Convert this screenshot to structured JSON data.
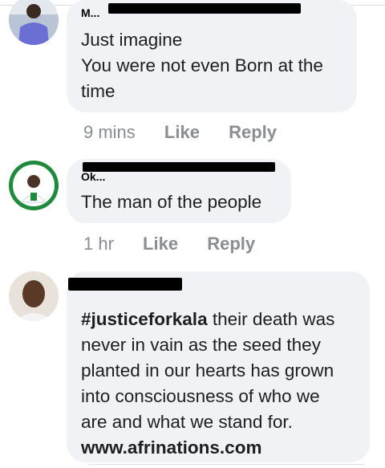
{
  "comments": [
    {
      "author": "M...",
      "lines": [
        "Just imagine",
        "You were not even Born at the",
        "time"
      ],
      "time": "9 mins",
      "like": "Like",
      "reply": "Reply"
    },
    {
      "author": "Ok...",
      "lines": [
        "The man of the people"
      ],
      "time": "1 hr",
      "like": "Like",
      "reply": "Reply"
    },
    {
      "author": "",
      "hashtag": "#justiceforkala",
      "lines": [
        " their death was",
        "never in vain as the seed they",
        "planted in our hearts has grown",
        "into consciousness of who we",
        "are and what we stand for."
      ],
      "link": "www.afrinations.com"
    }
  ],
  "colors": {
    "bubble": "#f0f2f5",
    "meta_text": "#8a8d91",
    "body_text": "#1c1e21"
  }
}
